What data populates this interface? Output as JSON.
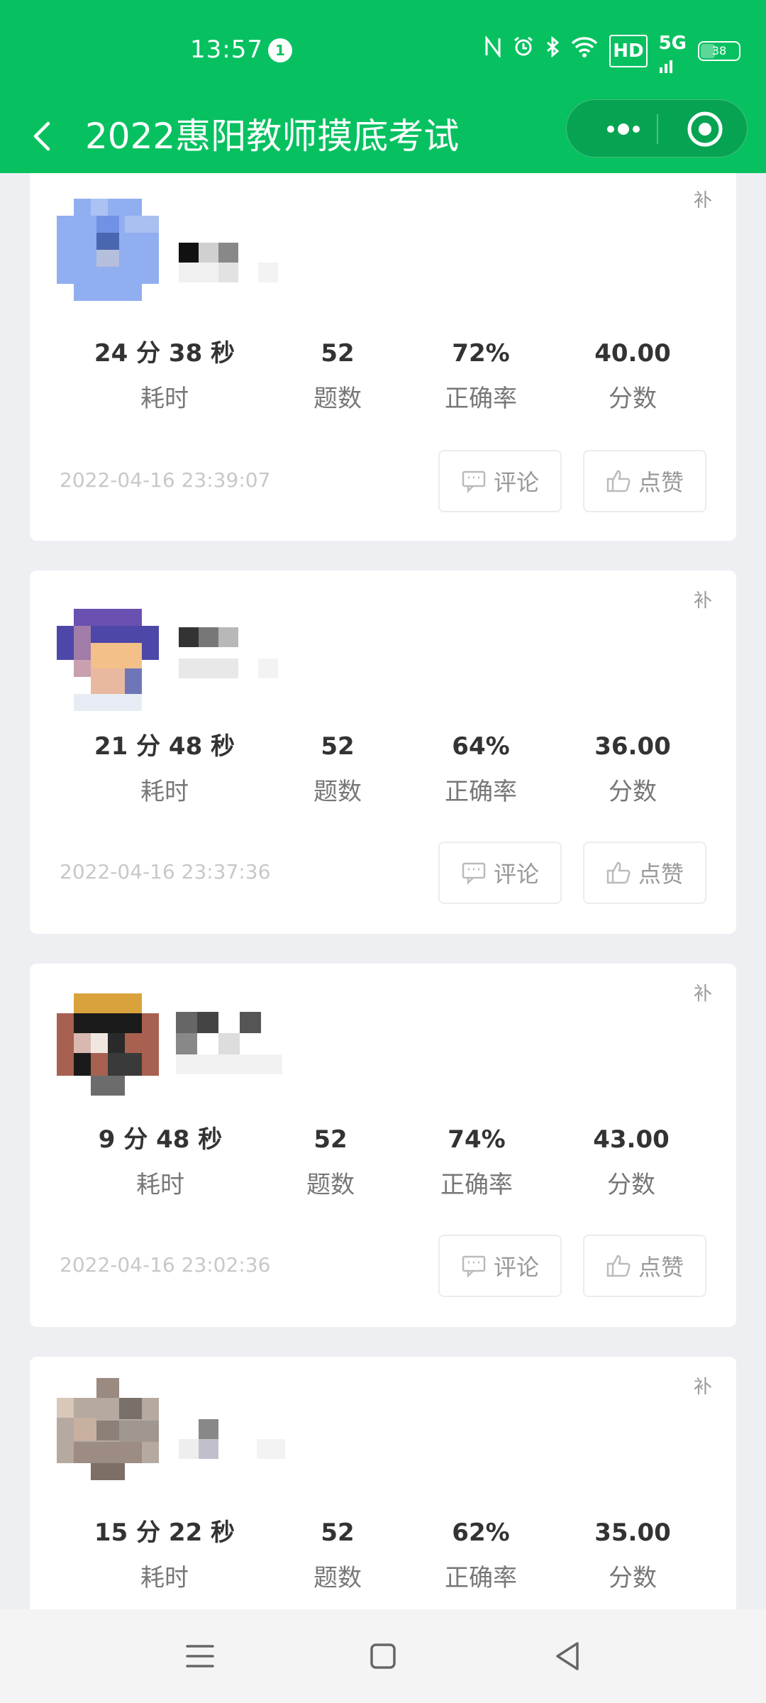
{
  "status_bar": {
    "time": "13:57",
    "notification_count": "1",
    "hd": "HD",
    "network": "5G",
    "battery": "38"
  },
  "nav": {
    "title": "2022惠阳教师摸底考试"
  },
  "labels": {
    "duration": "耗时",
    "questions": "题数",
    "accuracy": "正确率",
    "score": "分数",
    "comment": "评论",
    "like": "点赞",
    "bu": "补"
  },
  "records": [
    {
      "duration": "24 分 38 秒",
      "questions": "52",
      "accuracy": "72%",
      "score": "40.00",
      "date": "2022-04-16 23:39:07"
    },
    {
      "duration": "21 分 48 秒",
      "questions": "52",
      "accuracy": "64%",
      "score": "36.00",
      "date": "2022-04-16 23:37:36"
    },
    {
      "duration": "9 分 48 秒",
      "questions": "52",
      "accuracy": "74%",
      "score": "43.00",
      "date": "2022-04-16 23:02:36"
    },
    {
      "duration": "15 分 22 秒",
      "questions": "52",
      "accuracy": "62%",
      "score": "35.00"
    }
  ],
  "colors": {
    "brand_green": "#07c160",
    "page_bg": "#eeeff3"
  },
  "icons": {
    "back": "chevron-left-icon",
    "more": "more-dots-icon",
    "close": "target-circle-icon",
    "comment": "comment-bubble-icon",
    "like": "thumbs-up-icon",
    "menu": "menu-lines-icon",
    "home": "square-icon",
    "back_nav": "triangle-back-icon"
  }
}
